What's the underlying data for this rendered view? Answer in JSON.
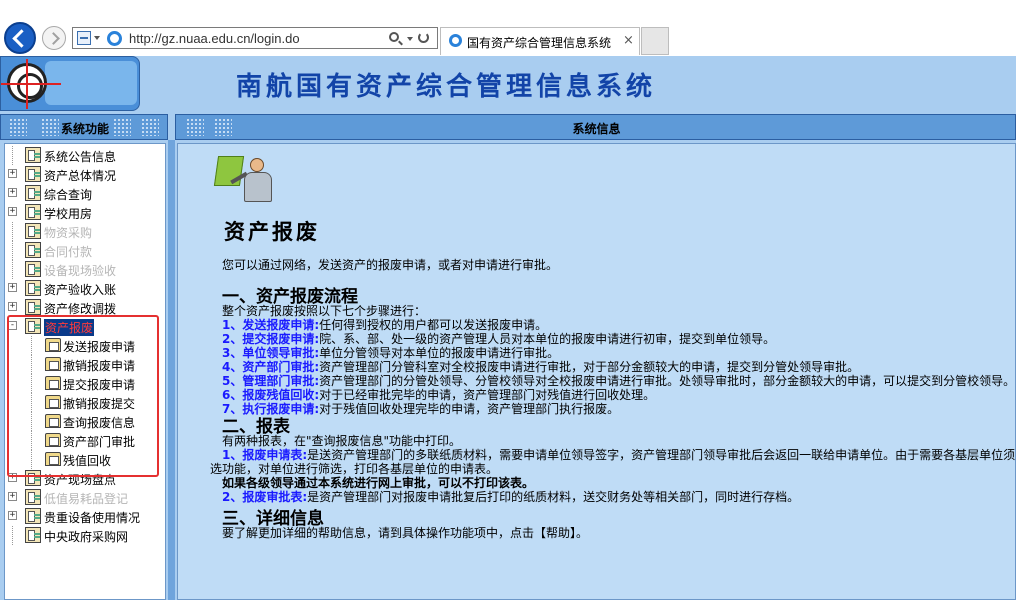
{
  "browser": {
    "url": "http://gz.nuaa.edu.cn/login.do",
    "tab_title": "国有资产综合管理信息系统",
    "tab_close": "×"
  },
  "site": {
    "title": "南航国有资产综合管理信息系统"
  },
  "left": {
    "header": "系统功能",
    "tree": [
      {
        "label": "系统公告信息",
        "expander": "",
        "state": "normal"
      },
      {
        "label": "资产总体情况",
        "expander": "+",
        "state": "normal"
      },
      {
        "label": "综合查询",
        "expander": "+",
        "state": "normal"
      },
      {
        "label": "学校用房",
        "expander": "+",
        "state": "normal"
      },
      {
        "label": "物资采购",
        "expander": "",
        "state": "disabled"
      },
      {
        "label": "合同付款",
        "expander": "",
        "state": "disabled"
      },
      {
        "label": "设备现场验收",
        "expander": "",
        "state": "disabled"
      },
      {
        "label": "资产验收入账",
        "expander": "+",
        "state": "normal"
      },
      {
        "label": "资产修改调拨",
        "expander": "+",
        "state": "normal"
      },
      {
        "label": "资产报废",
        "expander": "-",
        "state": "active",
        "children": [
          "发送报废申请",
          "撤销报废申请",
          "提交报废申请",
          "撤销报废提交",
          "查询报废信息",
          "资产部门审批",
          "残值回收"
        ]
      },
      {
        "label": "资产现场盘点",
        "expander": "+",
        "state": "normal"
      },
      {
        "label": "低值易耗品登记",
        "expander": "+",
        "state": "disabled"
      },
      {
        "label": "贵重设备使用情况",
        "expander": "+",
        "state": "normal"
      },
      {
        "label": "中央政府采购网",
        "expander": "",
        "state": "normal"
      }
    ]
  },
  "right": {
    "header": "系统信息"
  },
  "content": {
    "title": "资产报废",
    "intro": "您可以通过网络，发送资产的报废申请，或者对申请进行审批。",
    "sec1_title": "一、资产报废流程",
    "sec1_lead": "整个资产报废按照以下七个步骤进行：",
    "steps": [
      {
        "k": "1、发送报废申请:",
        "v": "任何得到授权的用户都可以发送报废申请。"
      },
      {
        "k": "2、提交报废申请:",
        "v": "院、系、部、处一级的资产管理人员对本单位的报废申请进行初审，提交到单位领导。"
      },
      {
        "k": "3、单位领导审批:",
        "v": "单位分管领导对本单位的报废申请进行审批。"
      },
      {
        "k": "4、资产部门审批:",
        "v": "资产管理部门分管科室对全校报废申请进行审批，对于部分金额较大的申请，提交到分管处领导审批。"
      },
      {
        "k": "5、管理部门审批:",
        "v": "资产管理部门的分管处领导、分管校领导对全校报废申请进行审批。处领导审批时，部分金额较大的申请，可以提交到分管校领导。"
      },
      {
        "k": "6、报废残值回收:",
        "v": "对于已经审批完毕的申请，资产管理部门对残值进行回收处理。"
      },
      {
        "k": "7、执行报废申请:",
        "v": "对于残值回收处理完毕的申请，资产管理部门执行报废。"
      }
    ],
    "sec2_title": "二、报表",
    "sec2_lead": "有两种报表，在\"查询报废信息\"功能中打印。",
    "report1_k": "1、报废申请表:",
    "report1_v": "是送资产管理部门的多联纸质材料，需要申请单位领导签字，资产管理部门领导审批后会返回一联给申请单位。由于需要各基层单位须",
    "report1_cont": "选功能，对单位进行筛选，打印各基层单位的申请表。",
    "report_note": "如果各级领导通过本系统进行网上审批，可以不打印该表。",
    "report2_k": "2、报废审批表:",
    "report2_v": "是资产管理部门对报废申请批复后打印的纸质材料，送交财务处等相关部门，同时进行存档。",
    "sec3_title": "三、详细信息",
    "sec3_text": "要了解更加详细的帮助信息，请到具体操作功能项中，点击【帮助】。"
  }
}
